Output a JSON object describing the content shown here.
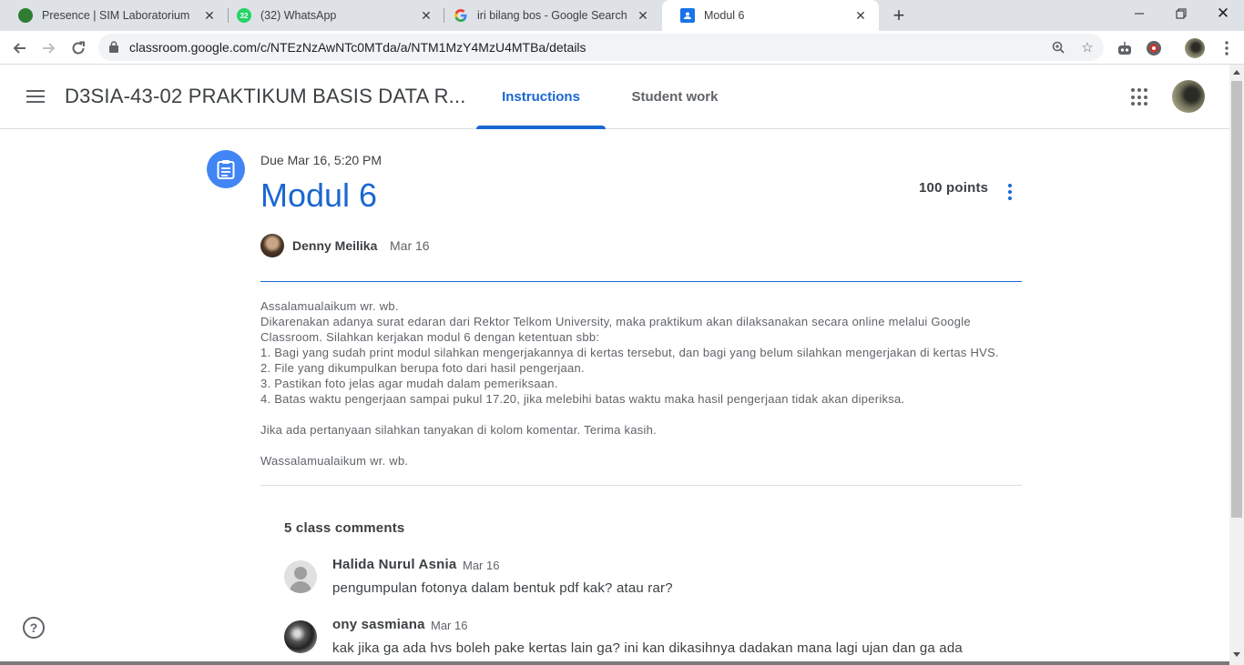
{
  "browser": {
    "tabs": [
      {
        "title": "Presence | SIM Laboratorium",
        "favicon": "globe-icon",
        "color": "#2e7d32"
      },
      {
        "title": "(32) WhatsApp",
        "favicon": "whatsapp-icon",
        "color": "#25d366",
        "badge": "32"
      },
      {
        "title": "iri bilang bos - Google Search",
        "favicon": "google-icon",
        "color": "#4285f4"
      },
      {
        "title": "Modul 6",
        "favicon": "classroom-icon",
        "color": "#1a73e8",
        "active": true
      }
    ],
    "url": "classroom.google.com/c/NTEzNzAwNTc0MTda/a/NTM1MzY4MzU4MTBa/details"
  },
  "header": {
    "class_title": "D3SIA-43-02 PRAKTIKUM BASIS DATA R...",
    "tabs": [
      {
        "label": "Instructions",
        "active": true
      },
      {
        "label": "Student work",
        "active": false
      }
    ]
  },
  "assignment": {
    "due": "Due Mar 16, 5:20 PM",
    "title": "Modul 6",
    "points": "100 points",
    "author": "Denny Meilika",
    "date": "Mar 16",
    "body": [
      "Assalamualaikum wr. wb.",
      "Dikarenakan adanya surat edaran dari Rektor Telkom University, maka praktikum akan dilaksanakan secara online melalui Google Classroom. Silahkan kerjakan modul 6 dengan ketentuan sbb:",
      "1. Bagi yang sudah print modul silahkan mengerjakannya di kertas tersebut, dan bagi yang belum silahkan mengerjakan di kertas HVS.",
      "2. File yang dikumpulkan berupa foto dari hasil pengerjaan.",
      "3. Pastikan foto jelas agar mudah dalam pemeriksaan.",
      "4. Batas waktu pengerjaan sampai pukul 17.20, jika melebihi batas waktu maka hasil pengerjaan tidak akan diperiksa.",
      "",
      "Jika ada pertanyaan silahkan tanyakan di kolom komentar. Terima kasih.",
      "",
      "Wassalamualaikum wr. wb."
    ]
  },
  "comments": {
    "heading": "5 class comments",
    "items": [
      {
        "name": "Halida Nurul Asnia",
        "date": "Mar 16",
        "text": "pengumpulan fotonya dalam bentuk pdf kak? atau rar?"
      },
      {
        "name": "ony sasmiana",
        "date": "Mar 16",
        "text": "kak jika ga ada hvs boleh pake kertas lain ga? ini kan dikasihnya dadakan mana lagi ujan dan ga ada"
      }
    ]
  },
  "help_label": "?"
}
